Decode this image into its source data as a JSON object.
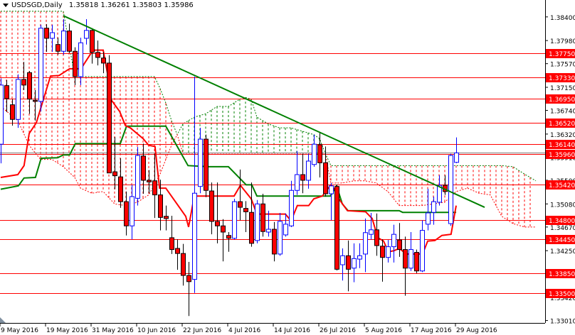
{
  "header": {
    "symbol": "USDSGD,Daily",
    "ohlc": "1.35818 1.36261 1.35803 1.35986"
  },
  "colors": {
    "bull": "#0000ff",
    "bear": "#ff0000",
    "tenkan": "#ff0000",
    "kijun": "#008000",
    "trendline": "#008000",
    "cloud_bear": "#ff0000",
    "cloud_bull": "#008000",
    "level": "#ff0000",
    "price_line": "#808080"
  },
  "chart_data": {
    "type": "candlestick",
    "title": "USDSGD,Daily",
    "ylim": [
      1.329,
      1.387
    ],
    "candles": [
      [
        1.3614,
        1.3731,
        1.358,
        1.3719
      ],
      [
        1.3718,
        1.3728,
        1.3671,
        1.3695
      ],
      [
        1.3684,
        1.3694,
        1.3647,
        1.3658
      ],
      [
        1.3658,
        1.3738,
        1.3643,
        1.3729
      ],
      [
        1.3729,
        1.376,
        1.371,
        1.3719
      ],
      [
        1.3741,
        1.3744,
        1.3668,
        1.3694
      ],
      [
        1.3692,
        1.371,
        1.3656,
        1.369
      ],
      [
        1.369,
        1.3826,
        1.3672,
        1.382
      ],
      [
        1.382,
        1.3827,
        1.3778,
        1.3802
      ],
      [
        1.3802,
        1.3826,
        1.3778,
        1.3812
      ],
      [
        1.3791,
        1.3803,
        1.3773,
        1.3779
      ],
      [
        1.3779,
        1.3836,
        1.3773,
        1.3815
      ],
      [
        1.3815,
        1.3828,
        1.3776,
        1.3779
      ],
      [
        1.3779,
        1.3786,
        1.3719,
        1.3734
      ],
      [
        1.3734,
        1.3803,
        1.3719,
        1.3794
      ],
      [
        1.3802,
        1.3836,
        1.3791,
        1.3816
      ],
      [
        1.3816,
        1.382,
        1.3757,
        1.3777
      ],
      [
        1.3777,
        1.3798,
        1.3754,
        1.3768
      ],
      [
        1.3767,
        1.3778,
        1.374,
        1.3758
      ],
      [
        1.3758,
        1.3772,
        1.3563,
        1.3563
      ],
      [
        1.3565,
        1.3627,
        1.3534,
        1.3558
      ],
      [
        1.3556,
        1.3589,
        1.3501,
        1.3512
      ],
      [
        1.3512,
        1.353,
        1.3452,
        1.3469
      ],
      [
        1.3469,
        1.3542,
        1.3445,
        1.3521
      ],
      [
        1.3518,
        1.3609,
        1.3505,
        1.3594
      ],
      [
        1.3593,
        1.3615,
        1.3526,
        1.355
      ],
      [
        1.355,
        1.3568,
        1.3527,
        1.3547
      ],
      [
        1.3549,
        1.3597,
        1.3483,
        1.3524
      ],
      [
        1.3524,
        1.3551,
        1.3461,
        1.3484
      ],
      [
        1.3486,
        1.3505,
        1.3461,
        1.3482
      ],
      [
        1.3448,
        1.3487,
        1.3419,
        1.3427
      ],
      [
        1.3429,
        1.3445,
        1.3391,
        1.342
      ],
      [
        1.342,
        1.3437,
        1.3363,
        1.3381
      ],
      [
        1.3381,
        1.3405,
        1.3309,
        1.337
      ],
      [
        1.3374,
        1.3734,
        1.335,
        1.3527
      ],
      [
        1.3539,
        1.3643,
        1.3527,
        1.3623
      ],
      [
        1.3623,
        1.3631,
        1.352,
        1.3532
      ],
      [
        1.3531,
        1.3546,
        1.3454,
        1.3477
      ],
      [
        1.3477,
        1.3546,
        1.3438,
        1.3469
      ],
      [
        1.3469,
        1.3481,
        1.3406,
        1.3458
      ],
      [
        1.3452,
        1.3458,
        1.3423,
        1.3447
      ],
      [
        1.3447,
        1.3517,
        1.3445,
        1.3512
      ],
      [
        1.3512,
        1.3569,
        1.3479,
        1.3502
      ],
      [
        1.35,
        1.3513,
        1.3458,
        1.3494
      ],
      [
        1.3493,
        1.3546,
        1.3432,
        1.3438
      ],
      [
        1.3443,
        1.3515,
        1.3438,
        1.3508
      ],
      [
        1.3508,
        1.3526,
        1.345,
        1.3459
      ],
      [
        1.3458,
        1.3496,
        1.345,
        1.3463
      ],
      [
        1.3463,
        1.3476,
        1.3406,
        1.3419
      ],
      [
        1.3419,
        1.3492,
        1.3416,
        1.3477
      ],
      [
        1.3453,
        1.3491,
        1.345,
        1.3472
      ],
      [
        1.3469,
        1.3549,
        1.3467,
        1.3532
      ],
      [
        1.3532,
        1.3602,
        1.3524,
        1.356
      ],
      [
        1.356,
        1.3597,
        1.3527,
        1.355
      ],
      [
        1.355,
        1.3597,
        1.3535,
        1.3584
      ],
      [
        1.3578,
        1.3631,
        1.3574,
        1.3614
      ],
      [
        1.3613,
        1.3634,
        1.3555,
        1.3581
      ],
      [
        1.3581,
        1.361,
        1.3521,
        1.3526
      ],
      [
        1.3526,
        1.3545,
        1.3479,
        1.354
      ],
      [
        1.3539,
        1.3542,
        1.339,
        1.3392
      ],
      [
        1.34,
        1.3429,
        1.3372,
        1.3416
      ],
      [
        1.3416,
        1.3443,
        1.3353,
        1.3392
      ],
      [
        1.3394,
        1.3438,
        1.3369,
        1.3411
      ],
      [
        1.341,
        1.3438,
        1.3394,
        1.3416
      ],
      [
        1.3419,
        1.3482,
        1.3387,
        1.3457
      ],
      [
        1.3454,
        1.3492,
        1.3445,
        1.3462
      ],
      [
        1.3462,
        1.3491,
        1.3416,
        1.3434
      ],
      [
        1.3433,
        1.3445,
        1.337,
        1.3413
      ],
      [
        1.3413,
        1.3444,
        1.3404,
        1.3432
      ],
      [
        1.3432,
        1.3471,
        1.3404,
        1.3454
      ],
      [
        1.3444,
        1.3474,
        1.3414,
        1.3427
      ],
      [
        1.3427,
        1.345,
        1.3345,
        1.3394
      ],
      [
        1.3394,
        1.3458,
        1.3389,
        1.3427
      ],
      [
        1.3422,
        1.3427,
        1.3385,
        1.3389
      ],
      [
        1.3389,
        1.3479,
        1.3387,
        1.3461
      ],
      [
        1.3472,
        1.3535,
        1.3461,
        1.3492
      ],
      [
        1.3493,
        1.3521,
        1.3471,
        1.3512
      ],
      [
        1.3511,
        1.3559,
        1.3505,
        1.3541
      ],
      [
        1.3541,
        1.3559,
        1.3524,
        1.353
      ],
      [
        1.3473,
        1.3597,
        1.3469,
        1.3594
      ],
      [
        1.35818,
        1.36261,
        1.35803,
        1.35986
      ]
    ],
    "tenkan": [
      [
        0,
        1.3555
      ],
      [
        3,
        1.356
      ],
      [
        4.1,
        1.3576
      ],
      [
        5,
        1.3633
      ],
      [
        6.25,
        1.3652
      ],
      [
        8.75,
        1.3735
      ],
      [
        10.25,
        1.3736
      ],
      [
        12.1,
        1.3748
      ],
      [
        14.1,
        1.3748
      ],
      [
        15.9,
        1.3776
      ],
      [
        16.5,
        1.3781
      ],
      [
        18,
        1.3781
      ],
      [
        18.75,
        1.374
      ],
      [
        19.1,
        1.3697
      ],
      [
        20.9,
        1.3672
      ],
      [
        21.9,
        1.3647
      ],
      [
        22.75,
        1.3643
      ],
      [
        25,
        1.3624
      ],
      [
        26,
        1.3612
      ],
      [
        27.1,
        1.361
      ],
      [
        27.9,
        1.3536
      ],
      [
        29,
        1.3536
      ],
      [
        32.5,
        1.3486
      ],
      [
        33,
        1.3467
      ],
      [
        34,
        1.3522
      ],
      [
        41,
        1.3522
      ],
      [
        42.1,
        1.3541
      ],
      [
        44,
        1.3517
      ],
      [
        45,
        1.349
      ],
      [
        50,
        1.349
      ],
      [
        51,
        1.3478
      ],
      [
        52.1,
        1.3505
      ],
      [
        54.1,
        1.3505
      ],
      [
        55,
        1.3517
      ],
      [
        56.5,
        1.3522
      ],
      [
        57.1,
        1.353
      ],
      [
        58,
        1.3542
      ],
      [
        58.75,
        1.3532
      ],
      [
        59.1,
        1.3521
      ],
      [
        60.9,
        1.3496
      ],
      [
        64.1,
        1.3494
      ],
      [
        65.25,
        1.3482
      ],
      [
        66.25,
        1.3448
      ],
      [
        67.25,
        1.3442
      ],
      [
        68.1,
        1.3423
      ],
      [
        69.1,
        1.3425
      ],
      [
        70,
        1.3429
      ],
      [
        71.25,
        1.3419
      ],
      [
        74.1,
        1.3419
      ],
      [
        75,
        1.3442
      ],
      [
        76.25,
        1.3443
      ],
      [
        77.5,
        1.3452
      ],
      [
        79.1,
        1.3454
      ],
      [
        80,
        1.3505
      ]
    ],
    "kijun": [
      [
        0,
        1.3534
      ],
      [
        3.1,
        1.354
      ],
      [
        4.1,
        1.3554
      ],
      [
        6.1,
        1.3555
      ],
      [
        7.1,
        1.3589
      ],
      [
        10,
        1.359
      ],
      [
        11,
        1.3595
      ],
      [
        12.1,
        1.3595
      ],
      [
        13.1,
        1.3615
      ],
      [
        21,
        1.3615
      ],
      [
        22.1,
        1.3646
      ],
      [
        29,
        1.3646
      ],
      [
        32.9,
        1.3576
      ],
      [
        36.6,
        1.3574
      ],
      [
        40,
        1.3574
      ],
      [
        43.1,
        1.3542
      ],
      [
        44.1,
        1.3542
      ],
      [
        45,
        1.3522
      ],
      [
        57.9,
        1.3522
      ],
      [
        59,
        1.354
      ],
      [
        60,
        1.3508
      ],
      [
        61,
        1.3496
      ],
      [
        70,
        1.3496
      ],
      [
        70.6,
        1.3493
      ],
      [
        80,
        1.3493
      ]
    ],
    "cloud": [
      [
        0,
        1.385,
        1.3681,
        "bear"
      ],
      [
        3,
        1.385,
        1.3656,
        "bear"
      ],
      [
        5,
        1.385,
        1.3612,
        "bear"
      ],
      [
        7,
        1.385,
        1.3587,
        "bear"
      ],
      [
        9,
        1.385,
        1.3587,
        "bear"
      ],
      [
        11,
        1.385,
        1.3574,
        "bear"
      ],
      [
        13,
        1.3734,
        1.3555,
        "bear"
      ],
      [
        14,
        1.3734,
        1.3536,
        "bear"
      ],
      [
        16,
        1.3734,
        1.3527,
        "bear"
      ],
      [
        18,
        1.3734,
        1.353,
        "bear"
      ],
      [
        20,
        1.3734,
        1.3508,
        "bear"
      ],
      [
        22,
        1.3734,
        1.3505,
        "bear"
      ],
      [
        24,
        1.3734,
        1.3511,
        "bear"
      ],
      [
        26,
        1.3734,
        1.3524,
        "bear"
      ],
      [
        27,
        1.3734,
        1.3542,
        "bear"
      ],
      [
        28,
        1.3713,
        1.3561,
        "bear"
      ],
      [
        29,
        1.3687,
        1.3587,
        "bear"
      ],
      [
        30,
        1.3656,
        1.3612,
        "bear"
      ],
      [
        31,
        1.3631,
        1.3631,
        "bear"
      ],
      [
        32,
        1.365,
        1.3598,
        "bull"
      ],
      [
        34,
        1.3662,
        1.3598,
        "bull"
      ],
      [
        36,
        1.3668,
        1.3598,
        "bull"
      ],
      [
        38,
        1.3681,
        1.3598,
        "bull"
      ],
      [
        40,
        1.3681,
        1.3598,
        "bull"
      ],
      [
        42,
        1.3694,
        1.3598,
        "bull"
      ],
      [
        43,
        1.3697,
        1.3598,
        "bull"
      ],
      [
        44,
        1.3694,
        1.3598,
        "bull"
      ],
      [
        45,
        1.3662,
        1.3598,
        "bull"
      ],
      [
        46,
        1.3656,
        1.3598,
        "bull"
      ],
      [
        47,
        1.365,
        1.3598,
        "bull"
      ],
      [
        49,
        1.3643,
        1.3598,
        "bull"
      ],
      [
        51,
        1.3643,
        1.3598,
        "bull"
      ],
      [
        53,
        1.3637,
        1.3598,
        "bull"
      ],
      [
        55,
        1.3631,
        1.3598,
        "bull"
      ],
      [
        56,
        1.3624,
        1.3598,
        "bull"
      ],
      [
        57,
        1.3598,
        1.3598,
        "bull"
      ],
      [
        58,
        1.3576,
        1.3545,
        "bear"
      ],
      [
        60,
        1.3576,
        1.3545,
        "bear"
      ],
      [
        62,
        1.3576,
        1.3549,
        "bear"
      ],
      [
        64,
        1.3576,
        1.3549,
        "bear"
      ],
      [
        66,
        1.3576,
        1.3545,
        "bear"
      ],
      [
        68,
        1.3576,
        1.353,
        "bear"
      ],
      [
        70,
        1.3576,
        1.3505,
        "bear"
      ],
      [
        72,
        1.3576,
        1.3505,
        "bear"
      ],
      [
        74,
        1.3576,
        1.3505,
        "bear"
      ],
      [
        76,
        1.3576,
        1.3508,
        "bear"
      ],
      [
        78,
        1.3576,
        1.3511,
        "bear"
      ],
      [
        80,
        1.3576,
        1.353,
        "bear"
      ],
      [
        82,
        1.3576,
        1.3536,
        "bear"
      ],
      [
        84,
        1.3576,
        1.3527,
        "bear"
      ],
      [
        86,
        1.3576,
        1.3524,
        "bear"
      ],
      [
        88,
        1.3576,
        1.3486,
        "bear"
      ],
      [
        90,
        1.3574,
        1.3473,
        "bear"
      ],
      [
        92,
        1.3561,
        1.3467,
        "bear"
      ],
      [
        94,
        1.3549,
        1.3467,
        "bear"
      ]
    ],
    "trendline": [
      [
        11,
        1.3842
      ],
      [
        85,
        1.3502
      ]
    ],
    "levels": [
      "1.37750",
      "1.37330",
      "1.36950",
      "1.36520",
      "1.36140",
      "1.35960",
      "1.35420",
      "1.34800",
      "1.34450",
      "1.33850",
      "1.33500"
    ],
    "current_price": 1.35986,
    "yticks": [
      "1.38400",
      "1.37980",
      "1.37570",
      "1.37150",
      "1.36740",
      "1.36320",
      "1.35910",
      "1.35500",
      "1.35080",
      "1.34670",
      "1.34250",
      "1.33840",
      "1.33420",
      "1.33010"
    ],
    "xticks": [
      {
        "bar": 0,
        "label": "9 May 2016"
      },
      {
        "bar": 8,
        "label": "19 May 2016"
      },
      {
        "bar": 16,
        "label": "31 May 2016"
      },
      {
        "bar": 24,
        "label": "10 Jun 2016"
      },
      {
        "bar": 32,
        "label": "22 Jun 2016"
      },
      {
        "bar": 40,
        "label": "4 Jul 2016"
      },
      {
        "bar": 48,
        "label": "14 Jul 2016"
      },
      {
        "bar": 56,
        "label": "26 Jul 2016"
      },
      {
        "bar": 64,
        "label": "5 Aug 2016"
      },
      {
        "bar": 72,
        "label": "17 Aug 2016"
      },
      {
        "bar": 80,
        "label": "29 Aug 2016"
      }
    ]
  }
}
